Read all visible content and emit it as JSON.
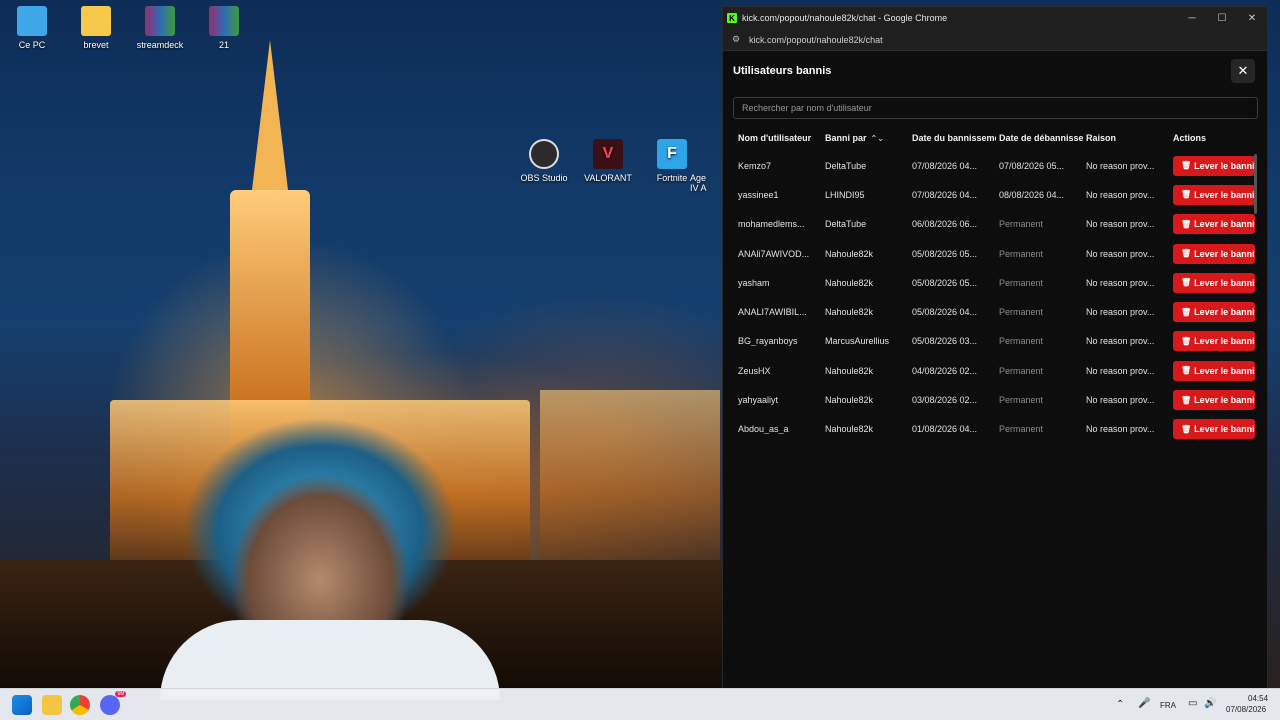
{
  "desktop": {
    "icons": [
      {
        "label": "Ce PC",
        "icon": "monitor-icon"
      },
      {
        "label": "brevet",
        "icon": "folder-icon"
      },
      {
        "label": "streamdeck",
        "icon": "winrar-icon"
      },
      {
        "label": "21",
        "icon": "winrar-icon"
      },
      {
        "label": "OBS Studio",
        "icon": "obs-icon"
      },
      {
        "label": "VALORANT",
        "icon": "valorant-icon"
      },
      {
        "label": "Fortnite",
        "icon": "fortnite-icon"
      },
      {
        "label": "Age\nIV A",
        "icon": "game-icon"
      }
    ]
  },
  "browser": {
    "title": "kick.com/popout/nahoule82k/chat - Google Chrome",
    "url": "kick.com/popout/nahoule82k/chat",
    "minimize": "─",
    "maximize": "☐",
    "close": "✕"
  },
  "panel": {
    "title": "Utilisateurs bannis",
    "close": "✕",
    "search_placeholder": "Rechercher par nom d'utilisateur",
    "columns": {
      "username": "Nom d'utilisateur",
      "banned_by": "Banni par",
      "ban_date": "Date du bannissement",
      "unban_date": "Date de débannissement",
      "reason": "Raison",
      "actions": "Actions"
    },
    "unban_label": "Lever le bannissement",
    "rows": [
      {
        "username": "Kemzo7",
        "banned_by": "DeltaTube",
        "ban_date": "07/08/2026 04...",
        "unban_date": "07/08/2026 05...",
        "unban_permanent": false,
        "reason": "No reason prov..."
      },
      {
        "username": "yassinee1",
        "banned_by": "LHINDI95",
        "ban_date": "07/08/2026 04...",
        "unban_date": "08/08/2026 04...",
        "unban_permanent": false,
        "reason": "No reason prov..."
      },
      {
        "username": "mohamedlems...",
        "banned_by": "DeltaTube",
        "ban_date": "06/08/2026 06...",
        "unban_date": "Permanent",
        "unban_permanent": true,
        "reason": "No reason prov..."
      },
      {
        "username": "ANAli7AWIVOD...",
        "banned_by": "Nahoule82k",
        "ban_date": "05/08/2026 05...",
        "unban_date": "Permanent",
        "unban_permanent": true,
        "reason": "No reason prov..."
      },
      {
        "username": "yasham",
        "banned_by": "Nahoule82k",
        "ban_date": "05/08/2026 05...",
        "unban_date": "Permanent",
        "unban_permanent": true,
        "reason": "No reason prov..."
      },
      {
        "username": "ANALI7AWIBIL...",
        "banned_by": "Nahoule82k",
        "ban_date": "05/08/2026 04...",
        "unban_date": "Permanent",
        "unban_permanent": true,
        "reason": "No reason prov..."
      },
      {
        "username": "BG_rayanboys",
        "banned_by": "MarcusAurellius",
        "ban_date": "05/08/2026 03...",
        "unban_date": "Permanent",
        "unban_permanent": true,
        "reason": "No reason prov..."
      },
      {
        "username": "ZeusHX",
        "banned_by": "Nahoule82k",
        "ban_date": "04/08/2026 02...",
        "unban_date": "Permanent",
        "unban_permanent": true,
        "reason": "No reason prov..."
      },
      {
        "username": "yahyaaliyt",
        "banned_by": "Nahoule82k",
        "ban_date": "03/08/2026 02...",
        "unban_date": "Permanent",
        "unban_permanent": true,
        "reason": "No reason prov..."
      },
      {
        "username": "Abdou_as_a",
        "banned_by": "Nahoule82k",
        "ban_date": "01/08/2026 04...",
        "unban_date": "Permanent",
        "unban_permanent": true,
        "reason": "No reason prov..."
      }
    ]
  },
  "taskbar": {
    "language": "FRA",
    "time": "04:54",
    "date": "07/08/2026",
    "discord_badge": "99"
  },
  "colors": {
    "accent_kick": "#53fc18",
    "unban_button": "#d7191c",
    "panel_bg": "#0d0d0e"
  }
}
